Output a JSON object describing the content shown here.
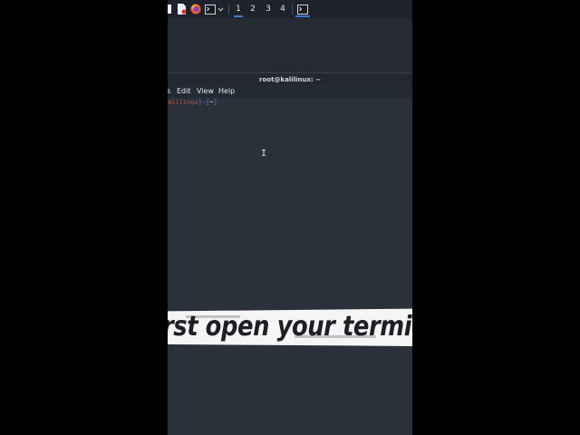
{
  "taskbar": {
    "icons": [
      "partial-app-icon",
      "files-icon",
      "firefox-icon",
      "terminal-icon",
      "chevron-down-icon"
    ],
    "workspaces": [
      "1",
      "2",
      "3",
      "4"
    ],
    "active_workspace": "1",
    "active_task": "terminal-task-icon"
  },
  "window": {
    "title": "root@kalilinux: ~"
  },
  "menu": {
    "items": [
      "s",
      "Edit",
      "View",
      "Help"
    ]
  },
  "terminal": {
    "prompt_user": "alilinux",
    "prompt_sep": ")-[",
    "prompt_dir": "~",
    "prompt_end": "]"
  },
  "caption": {
    "text": "rst open your termi"
  },
  "colors": {
    "taskbar": "#1e232b",
    "terminal_bg": "#2b313a",
    "accent": "#3d7ad6",
    "prompt_red": "#d8453c",
    "prompt_blue": "#5f8fd6",
    "caption_bg": "#f5f5f5",
    "caption_text": "#1c1f24"
  }
}
